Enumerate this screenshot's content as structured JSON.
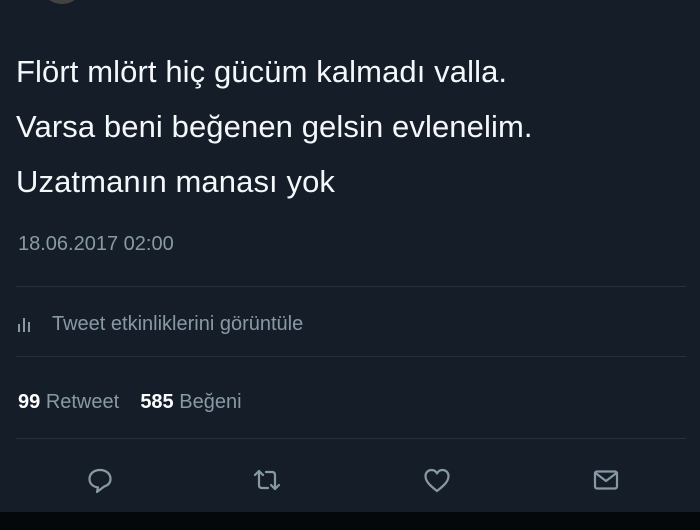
{
  "tweet": {
    "text_lines": [
      "Flört mlört hiç gücüm kalmadı valla.",
      "Varsa beni beğenen gelsin evlenelim.",
      "Uzatmanın manası yok"
    ],
    "timestamp": "18.06.2017 02:00"
  },
  "activity": {
    "label": "Tweet etkinliklerini görüntüle",
    "icon": "bar-chart-icon"
  },
  "stats": {
    "retweet_count": "99",
    "retweet_label": "Retweet",
    "like_count": "585",
    "like_label": "Beğeni"
  },
  "actions": [
    {
      "name": "reply",
      "icon": "speech-bubble-icon"
    },
    {
      "name": "retweet",
      "icon": "retweet-icon"
    },
    {
      "name": "like",
      "icon": "heart-icon"
    },
    {
      "name": "direct-message",
      "icon": "envelope-icon"
    }
  ],
  "colors": {
    "background": "#151e28",
    "text": "#f5f8fa",
    "muted": "#8899a6",
    "divider": "#24313f"
  }
}
